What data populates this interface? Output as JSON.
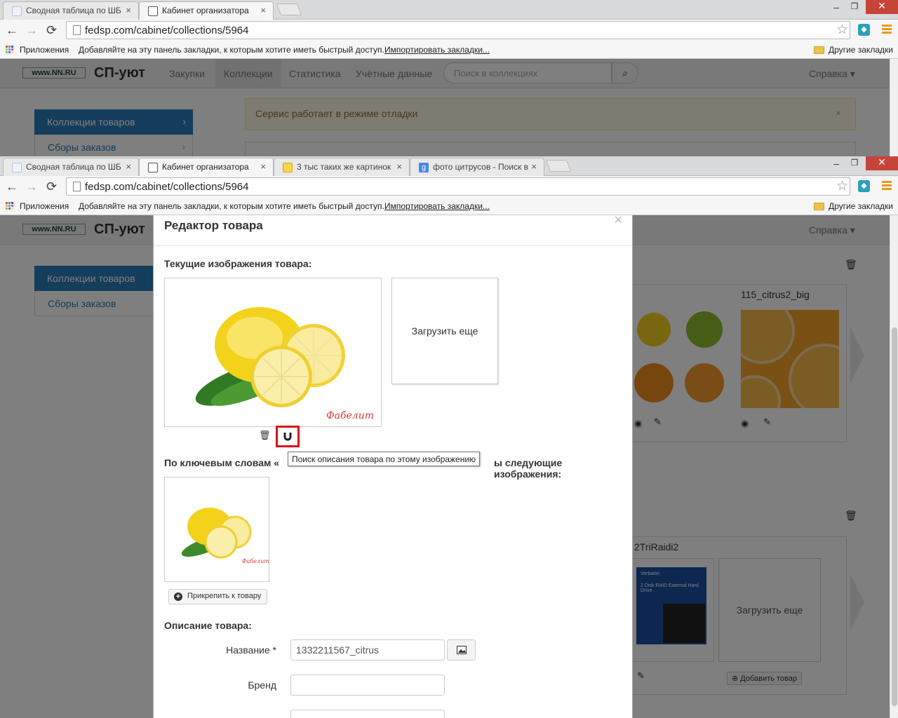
{
  "browser": {
    "tabs_top": [
      {
        "label": "Сводная таблица по ШБ",
        "close": "×"
      },
      {
        "label": "Кабинет организатора",
        "close": "×"
      }
    ],
    "tabs_bottom": [
      {
        "label": "Сводная таблица по ШБ",
        "close": "×"
      },
      {
        "label": "Кабинет организатора",
        "close": "×"
      },
      {
        "label": "3 тыс таких же картинок",
        "close": "×"
      },
      {
        "label": "фото цитрусов - Поиск в",
        "close": "×"
      }
    ],
    "window_controls": {
      "minimize": "–",
      "maximize": "❐",
      "close": "✕"
    },
    "url": "fedsp.com/cabinet/collections/5964",
    "bookmarks": {
      "apps": "Приложения",
      "hint": "Добавляйте на эту панель закладки, к которым хотите иметь быстрый доступ.",
      "import_link": "Импортировать закладки...",
      "other": "Другие закладки"
    },
    "nav": {
      "back": "←",
      "forward": "→",
      "reload": "⟳",
      "star": "☆"
    }
  },
  "site": {
    "logo": "www.NN.RU",
    "brand": "СП-уют",
    "nav_items": [
      "Закупки",
      "Коллекции",
      "Статистика",
      "Учётные данные"
    ],
    "search_placeholder": "Поиск в коллекциях",
    "search_icon": "🔍",
    "help": "Справка ▾",
    "sidebar": {
      "active": "Коллекции товаров",
      "item": "Сборы заказов",
      "chevron": "›"
    },
    "alert": "Сервис работает в режиме отладки",
    "alert_close": "×",
    "bg_cards": {
      "card1_title": "115_citrus2_big",
      "card2_title": "2TriRaidi2",
      "upload_more": "Загрузить еще",
      "add_product": "Добавить товар",
      "box_text": "2 Disk RAID External Hard Drive",
      "box_brand": "Verbatim"
    }
  },
  "modal": {
    "title": "Редактор товара",
    "close": "×",
    "current_images_label": "Текущие изображения товара:",
    "upload_more": "Загрузить еще",
    "trash_icon": "🗑",
    "tooltip": "Поиск описания товара по этому изображению",
    "keywords_label_start": "По ключевым словам «",
    "keywords_label_end": "ы следующие изображения:",
    "attach_button": "Прикрепить к товару",
    "attach_plus": "+",
    "description_label": "Описание товара:",
    "fields": {
      "name_label": "Название *",
      "name_value": "1332211567_citrus",
      "brand_label": "Бренд",
      "brand_value": ""
    },
    "watermark": "Фабелит"
  },
  "colors": {
    "accent": "#2a7ab8",
    "highlight_border": "#d8141c",
    "lemon": "#f2d21b",
    "leaf": "#3c8a2a",
    "orange": "#f39a1b"
  }
}
